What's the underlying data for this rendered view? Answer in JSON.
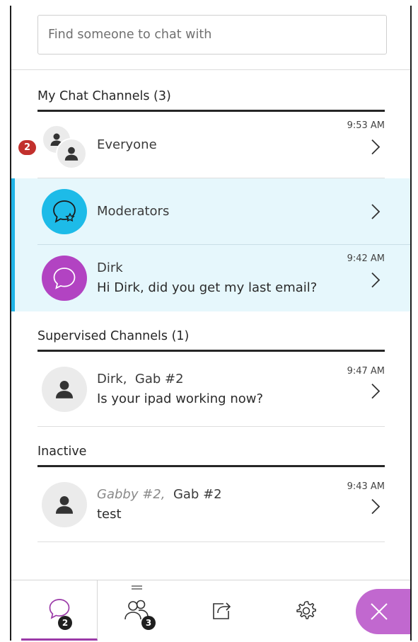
{
  "search": {
    "placeholder": "Find someone to chat with"
  },
  "sections": {
    "my_channels": {
      "title": "My Chat Channels (3)"
    },
    "supervised": {
      "title": "Supervised Channels (1)"
    },
    "inactive": {
      "title": "Inactive"
    }
  },
  "channels": {
    "everyone": {
      "name": "Everyone",
      "time": "9:53 AM",
      "unread": "2"
    },
    "moderators": {
      "name": "Moderators"
    },
    "dirk": {
      "name": "Dirk",
      "time": "9:42 AM",
      "preview": "Hi Dirk, did you get my last email?"
    },
    "supervised_dirk_gab": {
      "name_a": "Dirk",
      "separator": ",",
      "name_b": "Gab #2",
      "time": "9:47 AM",
      "preview": "Is your ipad working now?"
    },
    "inactive_gabby_gab": {
      "name_a": "Gabby #2",
      "separator": ",",
      "name_b": "Gab #2",
      "time": "9:43 AM",
      "preview": "test"
    }
  },
  "bottom_bar": {
    "chat_badge": "2",
    "participants_badge": "3"
  },
  "colors": {
    "accent_active": "#1fb3e6",
    "active_row_bg": "#e6f7fc",
    "moderators_avatar": "#1dbbe8",
    "dirk_avatar": "#b243c2",
    "unread_badge": "#c2302d",
    "close_button": "#c168cf",
    "active_tab_underline": "#9b3aa8"
  },
  "icons": {
    "search": "none",
    "everyone_avatar": "group-person-icon",
    "moderators_avatar": "chat-bubble-star-icon",
    "dirk_avatar": "chat-bubble-icon",
    "person_avatar": "person-icon",
    "row_chevron": "chevron-right-icon",
    "tab_chat": "chat-bubble-icon",
    "tab_participants": "people-icon",
    "tab_share": "share-icon",
    "tab_settings": "gear-icon",
    "close": "close-icon"
  }
}
